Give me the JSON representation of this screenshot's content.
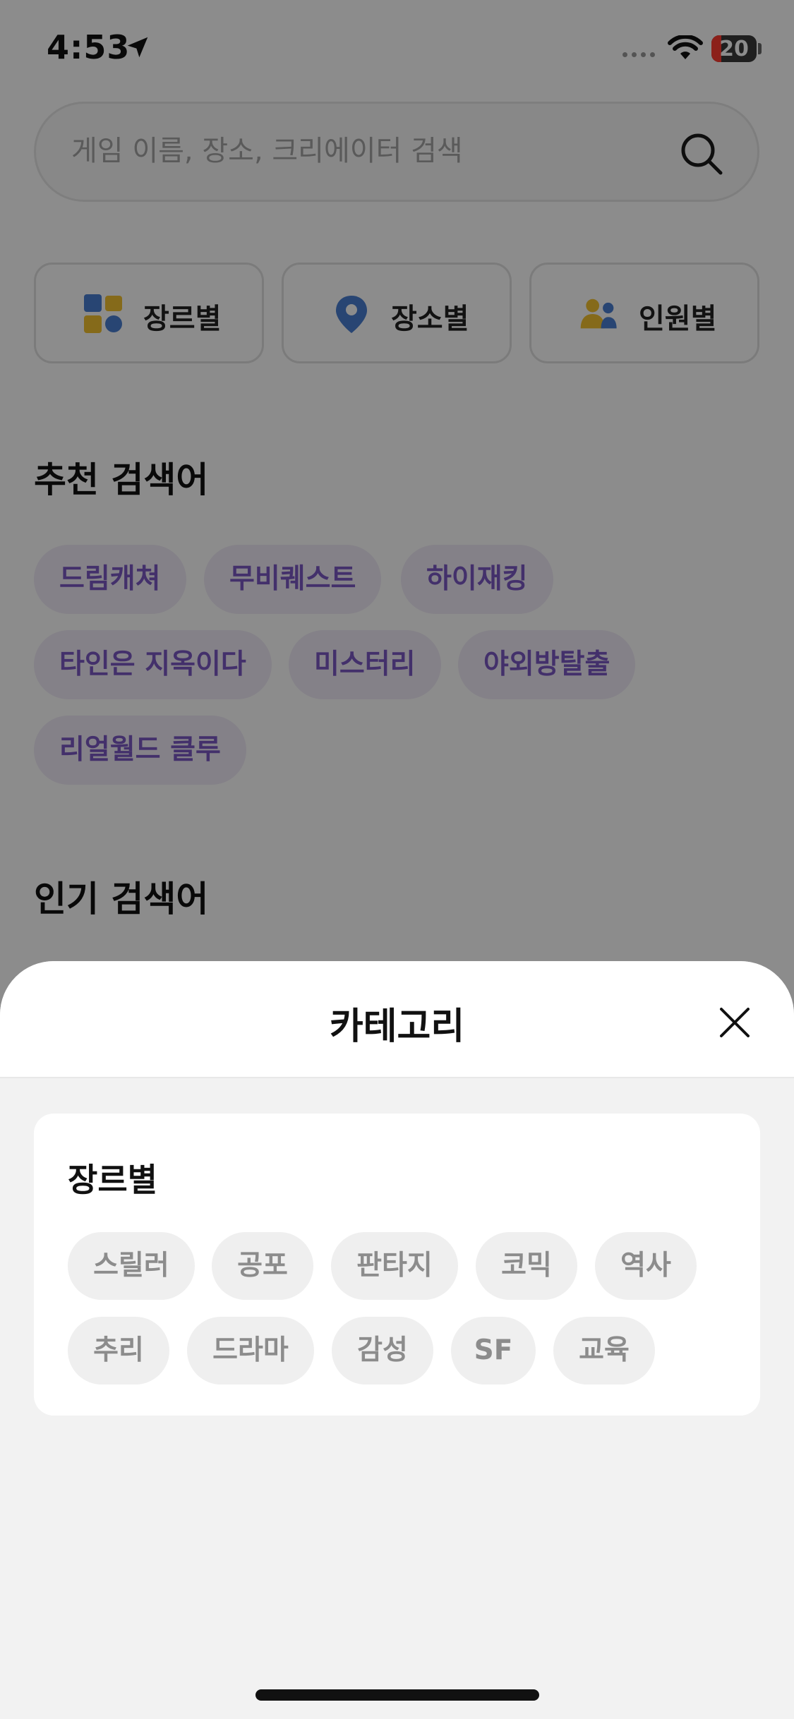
{
  "status_bar": {
    "time": "4:53",
    "battery_level": "20"
  },
  "search": {
    "placeholder": "게임 이름, 장소, 크리에이터 검색"
  },
  "categories": [
    {
      "label": "장르별",
      "icon": "grid-shapes-icon"
    },
    {
      "label": "장소별",
      "icon": "location-pin-icon"
    },
    {
      "label": "인원별",
      "icon": "people-icon"
    }
  ],
  "recommended": {
    "title": "추천 검색어",
    "items": [
      "드림캐쳐",
      "무비퀘스트",
      "하이재킹",
      "타인은 지옥이다",
      "미스터리",
      "야외방탈출",
      "리얼월드 클루"
    ]
  },
  "popular": {
    "title": "인기 검색어"
  },
  "sheet": {
    "title": "카테고리",
    "card_title": "장르별",
    "genres": [
      "스릴러",
      "공포",
      "판타지",
      "코믹",
      "역사",
      "추리",
      "드라마",
      "감성",
      "SF",
      "교육"
    ]
  },
  "colors": {
    "accent_purple": "#7b58c4",
    "chip_purple_bg": "#f1ecf7",
    "icon_blue": "#4a7fd1",
    "icon_yellow": "#f2c230",
    "sheet_bg": "#f2f2f2"
  }
}
